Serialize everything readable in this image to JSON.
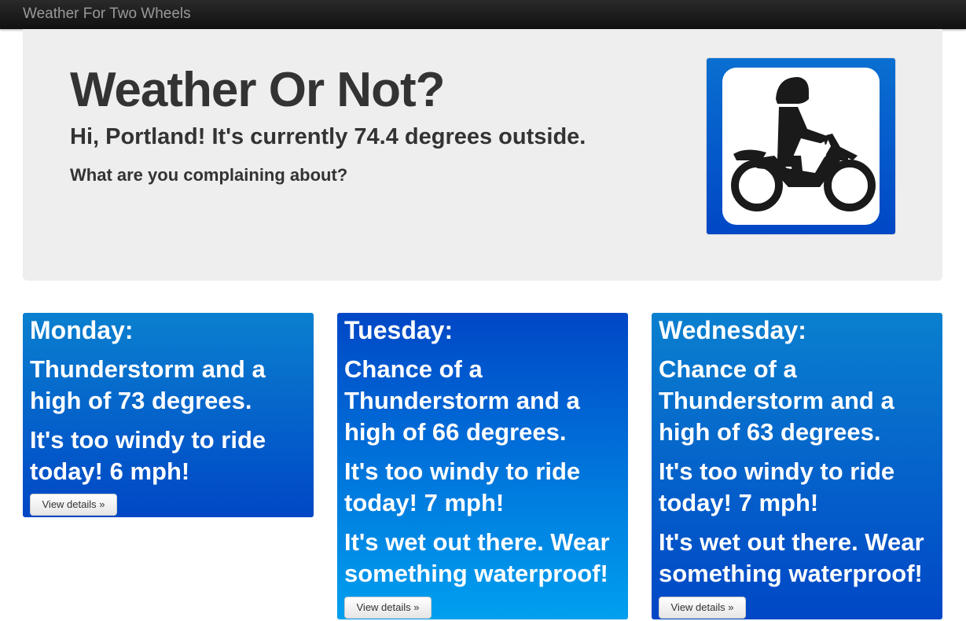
{
  "navbar": {
    "brand": "Weather For Two Wheels"
  },
  "hero": {
    "title": "Weather Or Not?",
    "subtitle": "Hi, Portland! It's currently 74.4 degrees outside.",
    "tagline": "What are you complaining about?",
    "logo_icon": "motorcycle-rider-icon"
  },
  "forecast": [
    {
      "day": "Monday:",
      "lines": [
        "Thunderstorm and a",
        "high of 73 degrees.",
        "It's too windy to ride",
        "today! 6 mph!"
      ],
      "button": "View details »"
    },
    {
      "day": "Tuesday:",
      "lines": [
        "Chance of a",
        "Thunderstorm and a",
        "high of 66 degrees.",
        "It's too windy to ride",
        "today! 7 mph!",
        "It's wet out there. Wear",
        "something waterproof!"
      ],
      "button": "View details »"
    },
    {
      "day": "Wednesday:",
      "lines": [
        "Chance of a",
        "Thunderstorm and a",
        "high of 63 degrees.",
        "It's too windy to ride",
        "today! 7 mph!",
        "It's wet out there. Wear",
        "something waterproof!"
      ],
      "button": "View details »"
    }
  ],
  "colors": {
    "card_blue": "#0047c6",
    "card_light_blue": "#00a0ef",
    "hero_bg": "#eeeeee",
    "navbar": "#1b1b1b"
  }
}
